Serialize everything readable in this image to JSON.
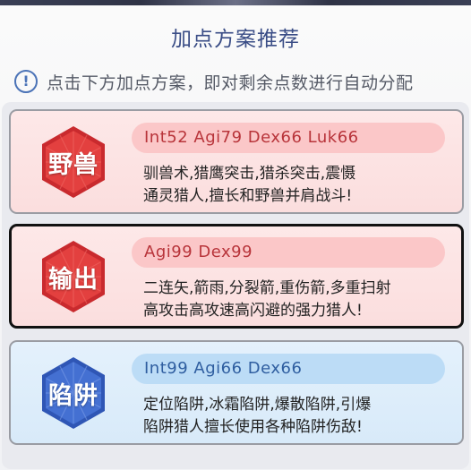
{
  "dialog": {
    "title": "加点方案推荐",
    "hint_icon": "info-circle-icon",
    "hint": "点击下方加点方案，即对剩余点数进行自动分配"
  },
  "plans": [
    {
      "name": "野兽",
      "theme": "red",
      "badge_color": "#e0393c",
      "stats": "Int52 Agi79 Dex66 Luk66",
      "desc_line1": "驯兽术,猎鹰突击,猎杀突击,震慑",
      "desc_line2": "通灵猎人,擅长和野兽并肩战斗!",
      "selected": false
    },
    {
      "name": "输出",
      "theme": "red",
      "badge_color": "#e0393c",
      "stats": "Agi99 Dex99",
      "desc_line1": "二连矢,箭雨,分裂箭,重伤箭,多重扫射",
      "desc_line2": "高攻击高攻速高闪避的强力猎人!",
      "selected": true
    },
    {
      "name": "陷阱",
      "theme": "blue",
      "badge_color": "#3d68c9",
      "stats": "Int99 Agi66 Dex66",
      "desc_line1": "定位陷阱,冰霜陷阱,爆散陷阱,引爆",
      "desc_line2": "陷阱猎人擅长使用各种陷阱伤敌!",
      "selected": false
    }
  ]
}
